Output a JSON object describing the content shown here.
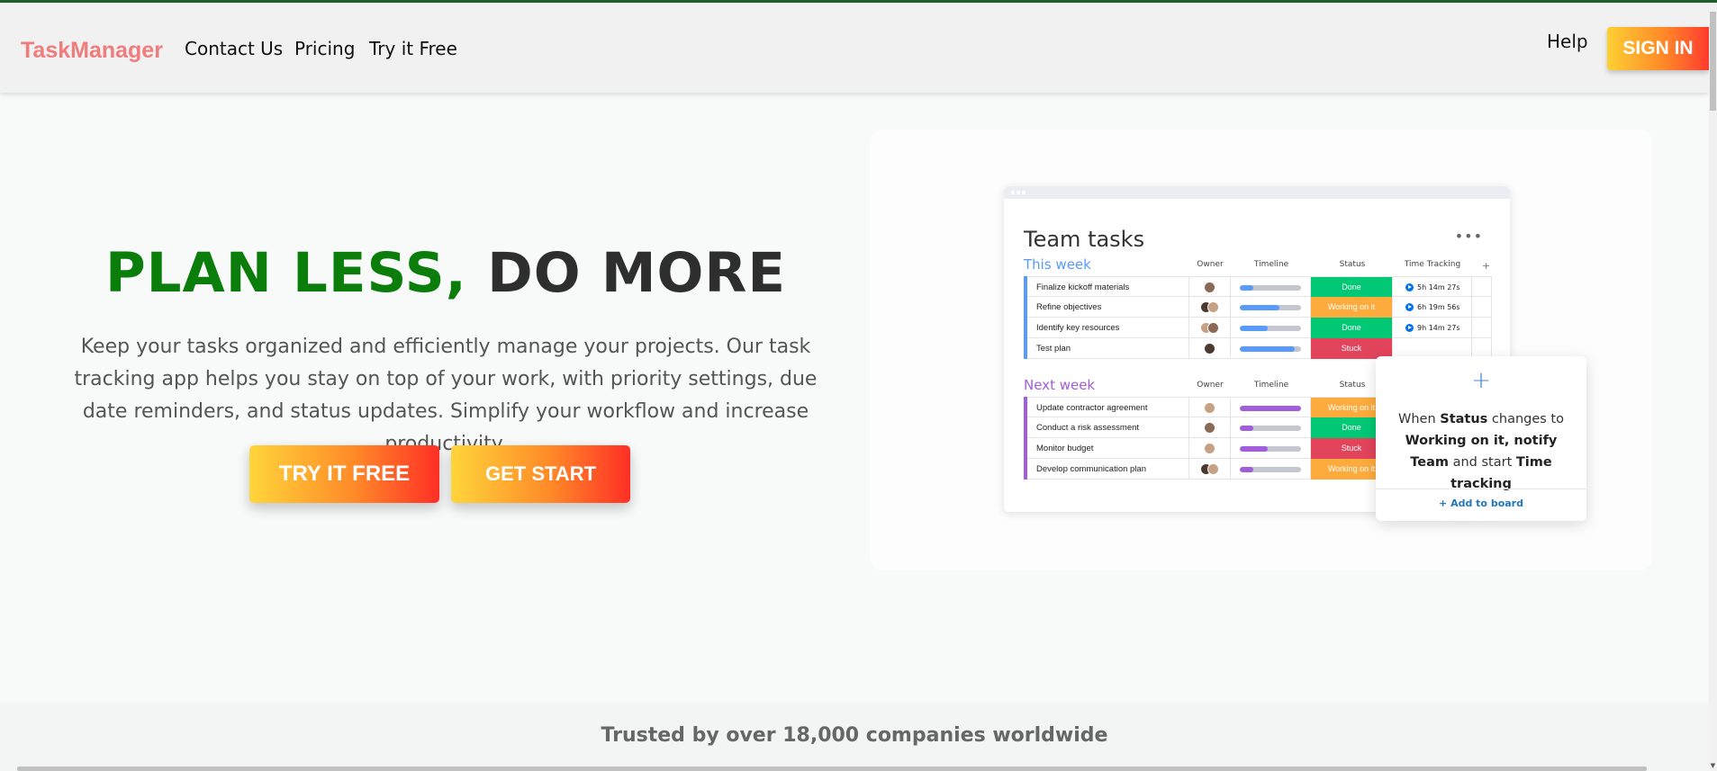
{
  "app": {
    "brand": "TaskManager"
  },
  "nav": {
    "links": [
      "Contact Us",
      "Pricing",
      "Try it Free"
    ],
    "help": "Help",
    "signin": "SIGN IN"
  },
  "hero": {
    "title_part1": "PLAN LESS,",
    "title_part2": "DO MORE",
    "description": "Keep your tasks organized and efficiently manage your projects. Our task tracking app helps you stay on top of your work, with priority settings, due date reminders, and status updates. Simplify your workflow and increase productivity.",
    "cta_primary": "TRY IT FREE",
    "cta_secondary": "GET START"
  },
  "board": {
    "title": "Team tasks",
    "menu": "•••",
    "columns": {
      "owner": "Owner",
      "timeline": "Timeline",
      "status": "Status",
      "time_tracking": "Time Tracking",
      "add": "+"
    },
    "groups": [
      {
        "title": "This week",
        "color": "#579bfc",
        "rows": [
          {
            "task": "Finalize kickoff materials",
            "status": "Done",
            "status_color": "#00c875",
            "progress": 0.22,
            "time": "5h 14m 27s"
          },
          {
            "task": "Refine objectives",
            "status": "Working on it",
            "status_color": "#fdab3d",
            "progress": 0.65,
            "time": "6h 19m 56s"
          },
          {
            "task": "Identify key resources",
            "status": "Done",
            "status_color": "#00c875",
            "progress": 0.45,
            "time": "9h 14m 27s"
          },
          {
            "task": "Test plan",
            "status": "Stuck",
            "status_color": "#e2445c",
            "progress": 0.9,
            "time": ""
          }
        ]
      },
      {
        "title": "Next week",
        "color": "#a25ddc",
        "rows": [
          {
            "task": "Update contractor agreement",
            "status": "Working on it",
            "status_color": "#fdab3d",
            "progress": 1.0,
            "time": ""
          },
          {
            "task": "Conduct a risk assessment",
            "status": "Done",
            "status_color": "#00c875",
            "progress": 0.22,
            "time": ""
          },
          {
            "task": "Monitor budget",
            "status": "Stuck",
            "status_color": "#e2445c",
            "progress": 0.45,
            "time": ""
          },
          {
            "task": "Develop communication plan",
            "status": "Working on it",
            "status_color": "#fdab3d",
            "progress": 0.22,
            "time": ""
          }
        ]
      }
    ]
  },
  "popup": {
    "plus": "+",
    "t1": "When ",
    "b1": "Status",
    "t2": " changes to ",
    "b2": "Working on it, notify Team",
    "t3": " and start ",
    "b3": "Time tracking",
    "link": "+ Add to board"
  },
  "trusted": "Trusted by over 18,000 companies worldwide",
  "colors": {
    "accent_green": "#0a7d0a",
    "brand": "#f07c7c",
    "gradient_start": "#ffd53a",
    "gradient_end": "#ff2f26"
  }
}
